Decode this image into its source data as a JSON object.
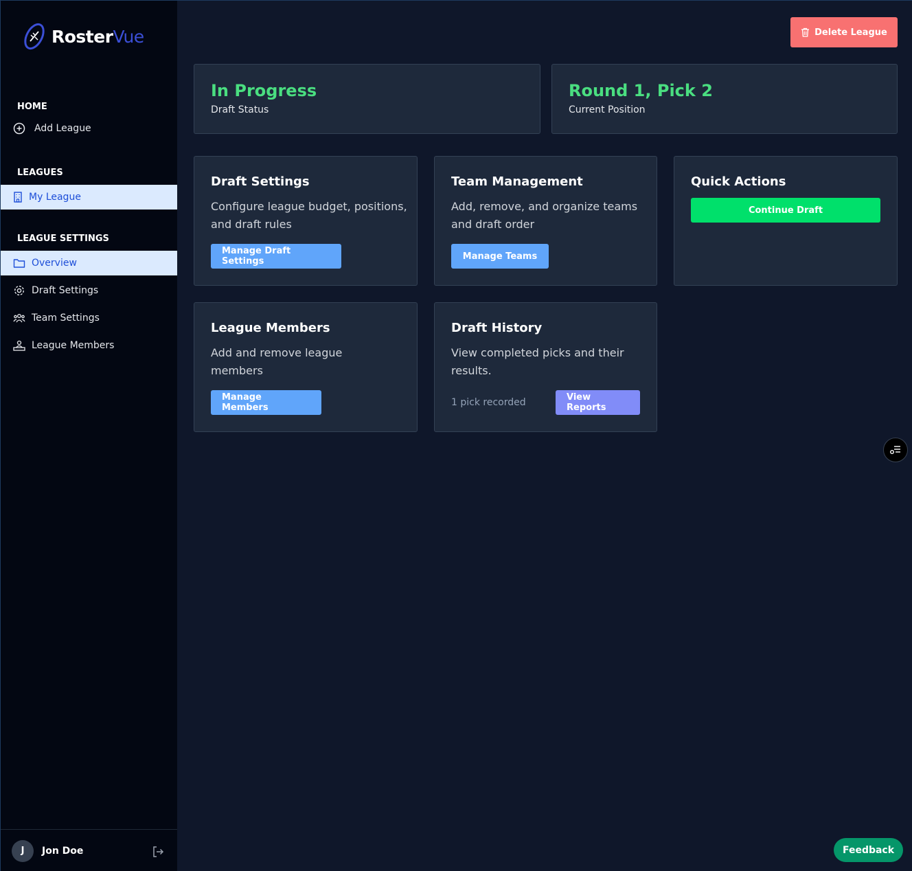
{
  "app": {
    "logo_primary": "Roster",
    "logo_accent": "Vue"
  },
  "sidebar": {
    "home_title": "HOME",
    "add_league": "Add League",
    "leagues_title": "LEAGUES",
    "my_league": "My League",
    "settings_title": "LEAGUE SETTINGS",
    "items": [
      {
        "label": "Overview",
        "icon": "folder-icon",
        "active": true
      },
      {
        "label": "Draft Settings",
        "icon": "gear-icon",
        "active": false
      },
      {
        "label": "Team Settings",
        "icon": "users-icon",
        "active": false
      },
      {
        "label": "League Members",
        "icon": "user-podium-icon",
        "active": false
      }
    ],
    "user": {
      "initial": "J",
      "name": "Jon Doe"
    }
  },
  "header": {
    "delete_label": "Delete League"
  },
  "stats": [
    {
      "value": "In Progress",
      "label": "Draft Status"
    },
    {
      "value": "Round 1, Pick 2",
      "label": "Current Position"
    }
  ],
  "cards": {
    "draft_settings": {
      "title": "Draft Settings",
      "desc": "Configure league budget, positions, and draft rules",
      "button": "Manage Draft Settings"
    },
    "team_management": {
      "title": "Team Management",
      "desc": "Add, remove, and organize teams and draft order",
      "button": "Manage Teams"
    },
    "quick_actions": {
      "title": "Quick Actions",
      "button": "Continue Draft"
    },
    "league_members": {
      "title": "League Members",
      "desc": "Add and remove league members",
      "button": "Manage Members"
    },
    "draft_history": {
      "title": "Draft History",
      "desc": "View completed picks and their results.",
      "count": "1 pick recorded",
      "button": "View Reports"
    }
  },
  "feedback_label": "Feedback",
  "colors": {
    "background": "#0f172a",
    "sidebar": "#030712",
    "card": "#1e293b",
    "status_green": "#4ade80",
    "primary_blue": "#60a5fa",
    "danger": "#f87171",
    "success": "#00e06b",
    "purple": "#818cf8"
  }
}
